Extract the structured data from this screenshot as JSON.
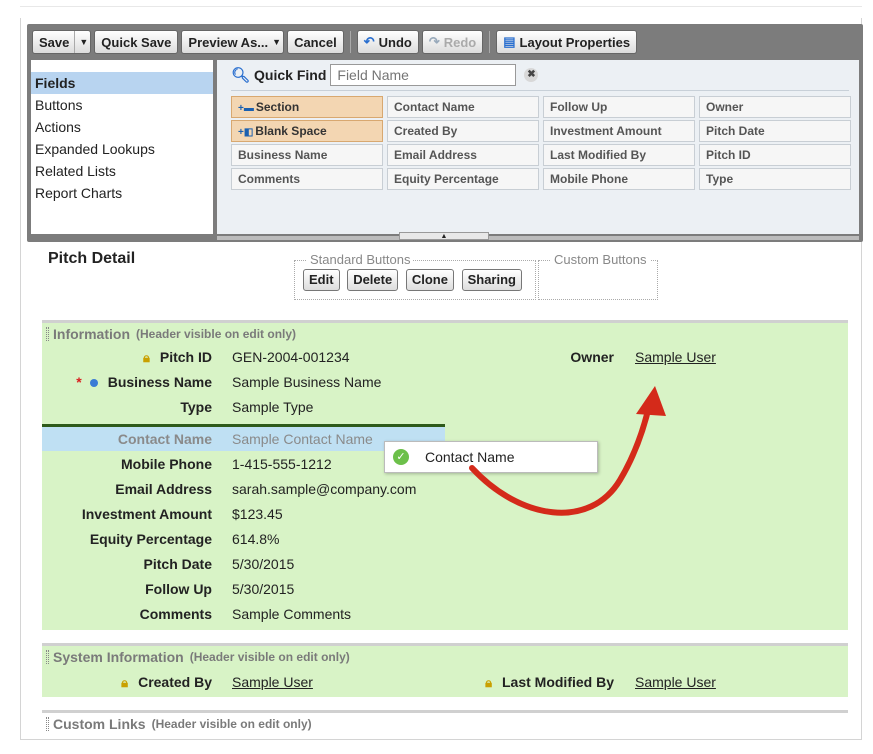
{
  "toolbar": {
    "save": "Save",
    "quick_save": "Quick Save",
    "preview_as": "Preview As...",
    "cancel": "Cancel",
    "undo": "Undo",
    "redo": "Redo",
    "layout_properties": "Layout Properties"
  },
  "sidebar": {
    "items": [
      {
        "label": "Fields",
        "active": true
      },
      {
        "label": "Buttons"
      },
      {
        "label": "Actions"
      },
      {
        "label": "Expanded Lookups"
      },
      {
        "label": "Related Lists"
      },
      {
        "label": "Report Charts"
      }
    ]
  },
  "quick_find": {
    "label": "Quick Find",
    "placeholder": "Field Name"
  },
  "palette_fields": [
    [
      "Section",
      "Contact Name",
      "Follow Up",
      "Owner"
    ],
    [
      "Blank Space",
      "Created By",
      "Investment Amount",
      "Pitch Date"
    ],
    [
      "Business Name",
      "Email Address",
      "Last Modified By",
      "Pitch ID"
    ],
    [
      "Comments",
      "Equity Percentage",
      "Mobile Phone",
      "Type"
    ]
  ],
  "page": {
    "title": "Pitch Detail",
    "standard_buttons": {
      "legend": "Standard Buttons",
      "buttons": [
        "Edit",
        "Delete",
        "Clone",
        "Sharing"
      ]
    },
    "custom_buttons": {
      "legend": "Custom Buttons"
    }
  },
  "information": {
    "title": "Information",
    "note": "(Header visible on edit only)",
    "left": [
      {
        "label": "Pitch ID",
        "value": "GEN-2004-001234"
      },
      {
        "label": "Business Name",
        "value": "Sample Business Name"
      },
      {
        "label": "Type",
        "value": "Sample Type"
      },
      {
        "label": "Contact Name",
        "value": "Sample Contact Name"
      },
      {
        "label": "Mobile Phone",
        "value": "1-415-555-1212"
      },
      {
        "label": "Email Address",
        "value": "sarah.sample@company.com"
      },
      {
        "label": "Investment Amount",
        "value": "$123.45"
      },
      {
        "label": "Equity Percentage",
        "value": "614.8%"
      },
      {
        "label": "Pitch Date",
        "value": "5/30/2015"
      },
      {
        "label": "Follow Up",
        "value": "5/30/2015"
      },
      {
        "label": "Comments",
        "value": "Sample Comments"
      }
    ],
    "right": {
      "label": "Owner",
      "value": "Sample User"
    }
  },
  "drag_tooltip": "Contact Name",
  "system_information": {
    "title": "System Information",
    "note": "(Header visible on edit only)",
    "created_by": {
      "label": "Created By",
      "value": "Sample User"
    },
    "last_modified_by": {
      "label": "Last Modified By",
      "value": "Sample User"
    }
  },
  "custom_links": {
    "title": "Custom Links",
    "note": "(Header visible on edit only)"
  },
  "colors": {
    "section_bg": "#d8f3c6",
    "drop_indicator": "#2e5a1a",
    "arrow": "#d42a1a"
  }
}
